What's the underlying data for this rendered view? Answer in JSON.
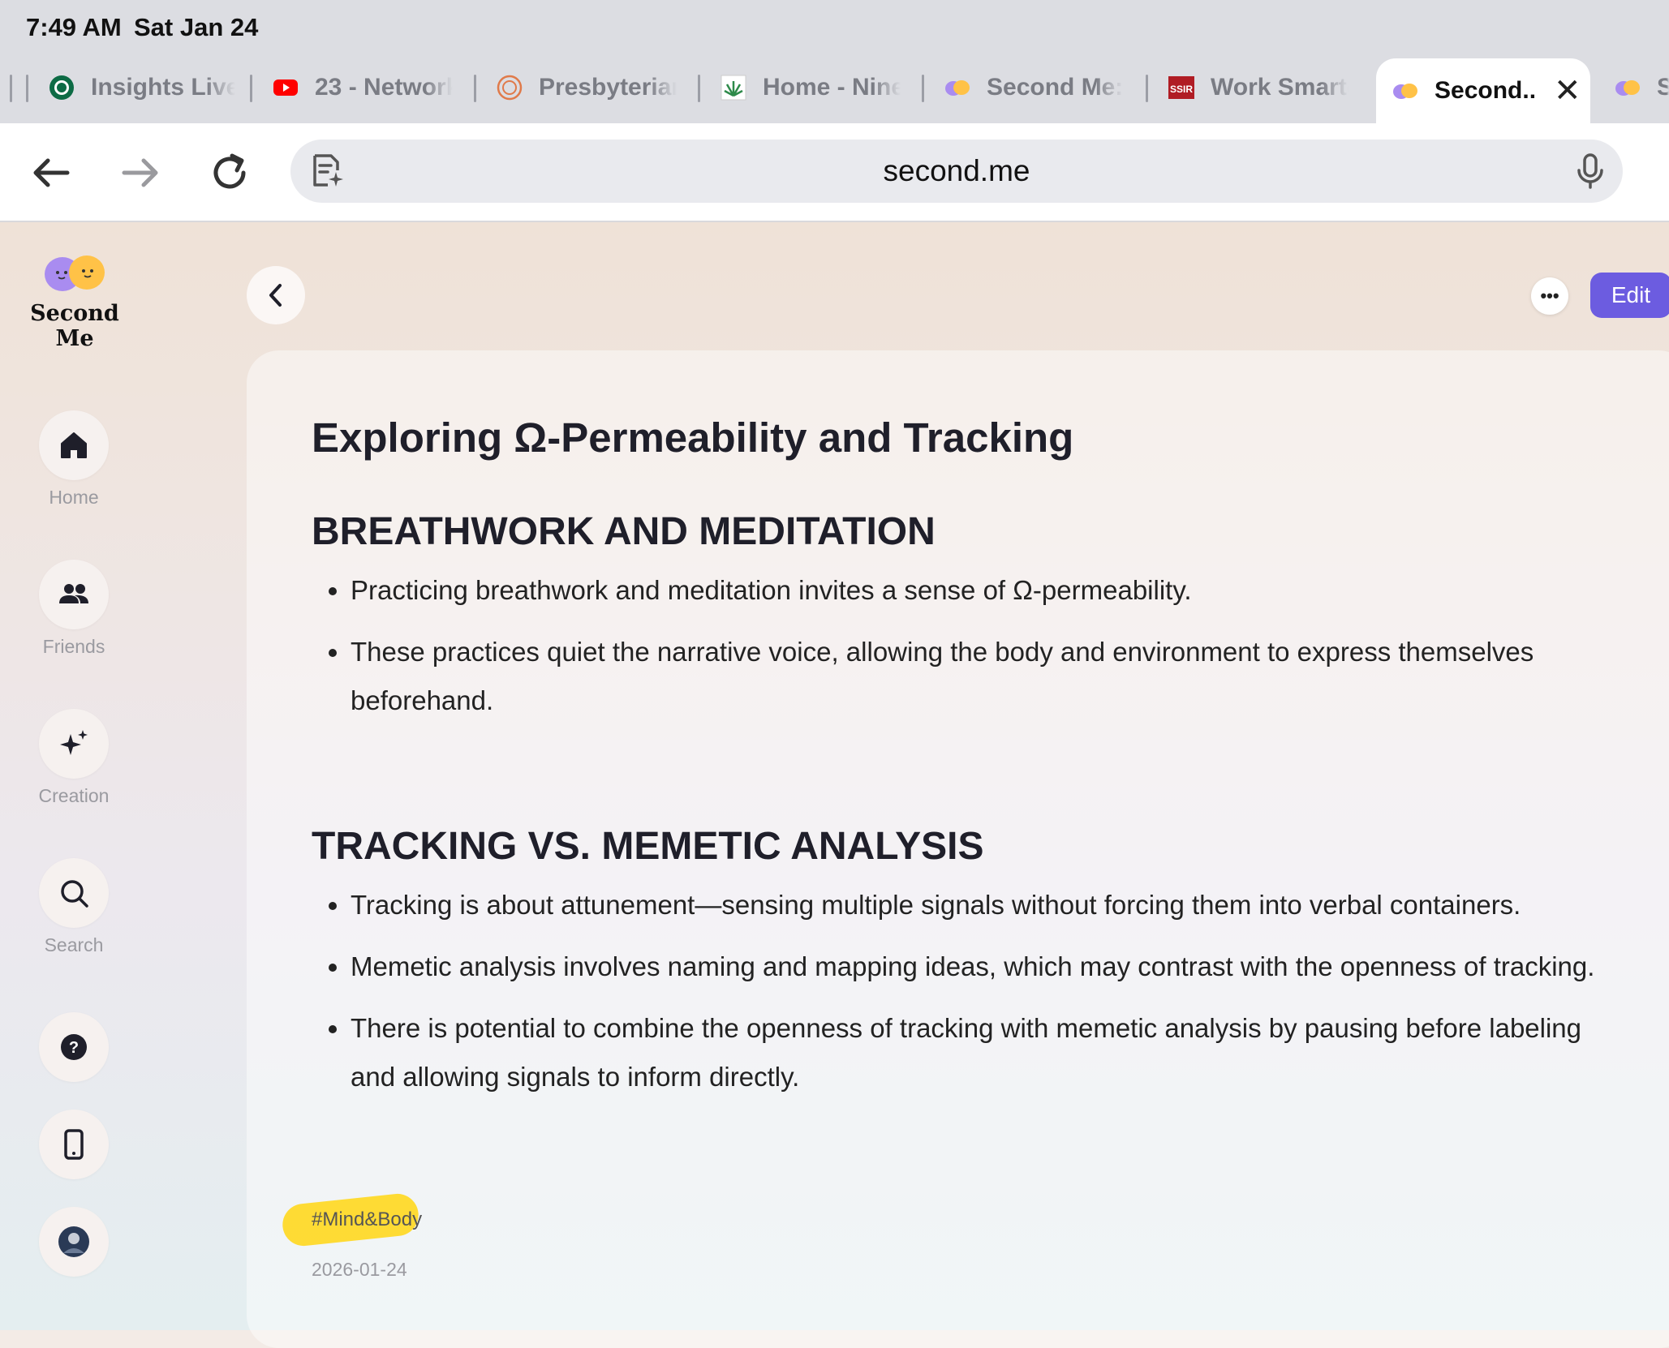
{
  "status": {
    "time": "7:49 AM",
    "date": "Sat Jan 24"
  },
  "tabs": [
    {
      "label": "Insights Live",
      "icon": "starbucks-icon"
    },
    {
      "label": "23 - Network",
      "icon": "youtube-icon"
    },
    {
      "label": "Presbyterian",
      "icon": "presbyterian-icon"
    },
    {
      "label": "Home - Nine",
      "icon": "aloe-icon"
    },
    {
      "label": "Second Me:",
      "icon": "second-me-icon"
    },
    {
      "label": "Work Smarte",
      "icon": "ssir-icon"
    },
    {
      "label": "Second..",
      "icon": "second-me-icon",
      "active": true
    },
    {
      "label": "S",
      "icon": "second-me-icon"
    }
  ],
  "ssir_text": "SSIR",
  "address": {
    "url": "second.me"
  },
  "app": {
    "name": "Second Me",
    "nav": [
      {
        "label": "Home",
        "icon": "home-icon"
      },
      {
        "label": "Friends",
        "icon": "friends-icon"
      },
      {
        "label": "Creation",
        "icon": "sparkle-icon"
      },
      {
        "label": "Search",
        "icon": "search-icon"
      }
    ],
    "help_glyph": "?",
    "edit_label": "Edit",
    "more_label": "•••"
  },
  "note": {
    "title": "Exploring Ω-Permeability and Tracking",
    "sections": [
      {
        "heading": "BREATHWORK AND MEDITATION",
        "bullets": [
          "Practicing breathwork and meditation invites a sense of Ω-permeability.",
          "These practices quiet the narrative voice, allowing the body and environment to express themselves beforehand."
        ]
      },
      {
        "heading": "TRACKING VS. MEMETIC ANALYSIS",
        "bullets": [
          "Tracking is about attunement—sensing multiple signals without forcing them into verbal containers.",
          "Memetic analysis involves naming and mapping ideas, which may contrast with the openness of tracking.",
          "There is potential to combine the openness of tracking with memetic analysis by pausing before labeling and allowing signals to inform directly."
        ]
      }
    ],
    "tag": "#Mind&Body",
    "date": "2026-01-24"
  },
  "colors": {
    "accent": "#6c5ce0",
    "highlight": "#ffd81f"
  }
}
